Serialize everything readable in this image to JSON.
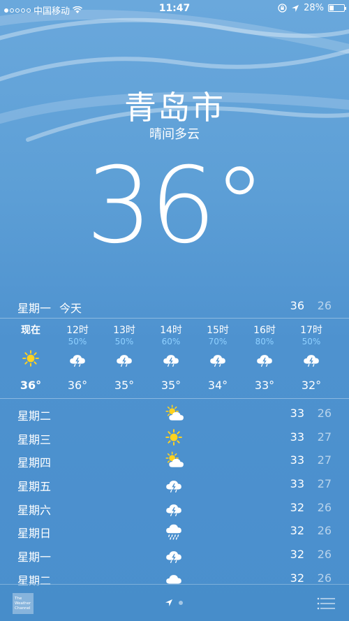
{
  "status_bar": {
    "carrier": "中国移动",
    "time": "11:47",
    "battery": "28%",
    "battery_level": 0.28,
    "signal_bars": 1
  },
  "location": {
    "city": "青岛市",
    "condition": "晴间多云",
    "temperature": "36°"
  },
  "today": {
    "day": "星期一",
    "label": "今天",
    "high": "36",
    "low": "26"
  },
  "hourly": [
    {
      "hour": "现在",
      "precip": "",
      "icon": "sun-icon",
      "temp": "36°"
    },
    {
      "hour": "12时",
      "precip": "50%",
      "icon": "thunderstorm-icon",
      "temp": "36°"
    },
    {
      "hour": "13时",
      "precip": "50%",
      "icon": "thunderstorm-icon",
      "temp": "35°"
    },
    {
      "hour": "14时",
      "precip": "60%",
      "icon": "thunderstorm-icon",
      "temp": "35°"
    },
    {
      "hour": "15时",
      "precip": "70%",
      "icon": "thunderstorm-icon",
      "temp": "34°"
    },
    {
      "hour": "16时",
      "precip": "80%",
      "icon": "thunderstorm-icon",
      "temp": "33°"
    },
    {
      "hour": "17时",
      "precip": "50%",
      "icon": "thunderstorm-icon",
      "temp": "32°"
    }
  ],
  "daily": [
    {
      "day": "星期二",
      "icon": "partly-cloudy-icon",
      "high": "33",
      "low": "26"
    },
    {
      "day": "星期三",
      "icon": "sun-icon",
      "high": "33",
      "low": "27"
    },
    {
      "day": "星期四",
      "icon": "partly-cloudy-icon",
      "high": "33",
      "low": "27"
    },
    {
      "day": "星期五",
      "icon": "thunderstorm-icon",
      "high": "33",
      "low": "27"
    },
    {
      "day": "星期六",
      "icon": "thunderstorm-icon",
      "high": "32",
      "low": "26"
    },
    {
      "day": "星期日",
      "icon": "rain-icon",
      "high": "32",
      "low": "26"
    },
    {
      "day": "星期一",
      "icon": "thunderstorm-icon",
      "high": "32",
      "low": "26"
    },
    {
      "day": "星期二",
      "icon": "cloud-icon",
      "high": "32",
      "low": "26"
    }
  ],
  "footer": {
    "brand_logo": "The Weather Channel"
  },
  "colors": {
    "sky_top": "#6aa8dc",
    "sky_bottom": "#4a8fcd",
    "precip_text": "#8fd0ff",
    "sun": "#ffd21f"
  }
}
